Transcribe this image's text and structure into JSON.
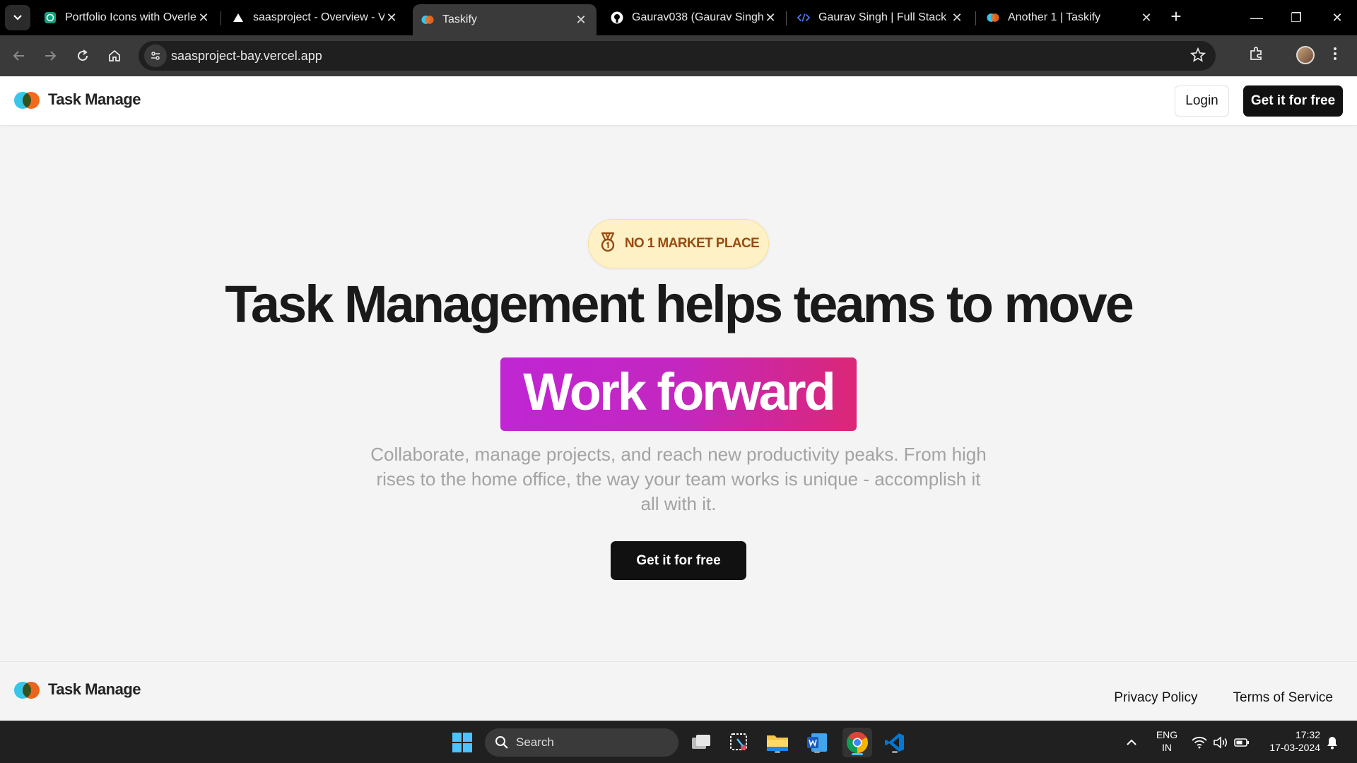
{
  "browser": {
    "tabs": [
      {
        "title": "Portfolio Icons with Overle",
        "favicon": "openai-icon",
        "active": false
      },
      {
        "title": "saasproject - Overview - Ve",
        "favicon": "vercel-triangle-icon",
        "active": false
      },
      {
        "title": "Taskify",
        "favicon": "taskify-logo-icon",
        "active": true
      },
      {
        "title": "Gaurav038 (Gaurav Singh)",
        "favicon": "github-icon",
        "active": false
      },
      {
        "title": "Gaurav Singh | Full Stack D",
        "favicon": "code-icon",
        "active": false
      },
      {
        "title": "Another 1 | Taskify",
        "favicon": "taskify-logo-icon",
        "active": false
      }
    ],
    "url": "saasproject-bay.vercel.app"
  },
  "site": {
    "logo_text": "Task Manage",
    "header": {
      "login_label": "Login",
      "cta_label": "Get it for free"
    },
    "hero": {
      "badge": "NO 1 MARKET PLACE",
      "title": "Task Management helps teams to move",
      "highlight": "Work forward",
      "description": "Collaborate, manage projects, and reach new productivity peaks. From high rises to the home office, the way your team works is unique - accomplish it all with it.",
      "cta_label": "Get it for free"
    },
    "footer": {
      "logo_text": "Task Manage",
      "links": [
        "Privacy Policy",
        "Terms of Service"
      ]
    },
    "colors": {
      "highlight_start": "#c026d3",
      "highlight_end": "#db2777",
      "badge_bg": "#fdf1c5",
      "badge_text": "#9a4a12",
      "dark_button": "#111111"
    }
  },
  "taskbar": {
    "search_placeholder": "Search",
    "language": "ENG",
    "region": "IN",
    "time": "17:32",
    "date": "17-03-2024"
  }
}
